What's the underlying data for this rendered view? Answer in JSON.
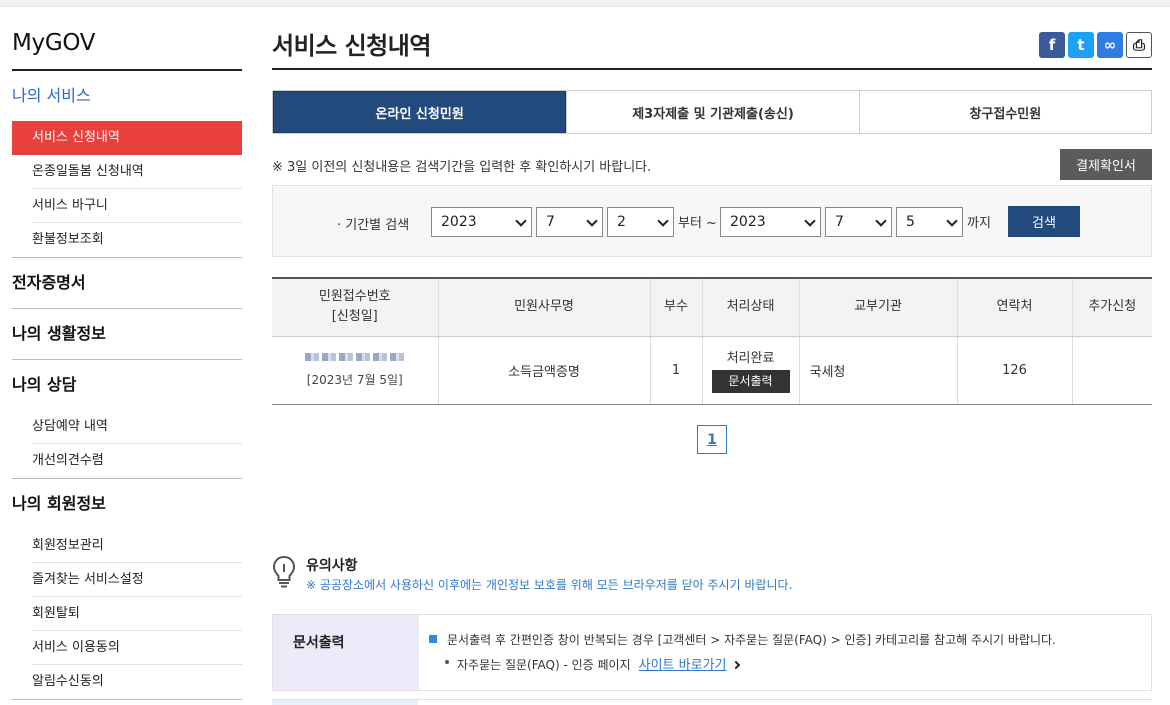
{
  "sidebar": {
    "brand": "MyGOV",
    "sections": [
      {
        "title": "나의 서비스",
        "items": [
          "서비스 신청내역",
          "온종일돌봄 신청내역",
          "서비스 바구니",
          "환불정보조회"
        ]
      },
      {
        "title": "전자증명서",
        "items": []
      },
      {
        "title": "나의 생활정보",
        "items": []
      },
      {
        "title": "나의 상담",
        "items": [
          "상담예약 내역",
          "개선의견수렴"
        ]
      },
      {
        "title": "나의 회원정보",
        "items": [
          "회원정보관리",
          "즐겨찾는 서비스설정",
          "회원탈퇴",
          "서비스 이용동의",
          "알림수신동의"
        ]
      }
    ]
  },
  "page": {
    "title": "서비스 신청내역",
    "share": {
      "facebook": "f",
      "twitter": "t",
      "link": "∞",
      "print": "⎙"
    }
  },
  "tabs": [
    "온라인 신청민원",
    "제3자제출 및 기관제출(송신)",
    "창구접수민원"
  ],
  "notice": "※ 3일 이전의 신청내용은 검색기간을 입력한 후 확인하시기 바랍니다.",
  "receipt_button": "결제확인서",
  "search": {
    "label": "· 기간별 검색",
    "from": {
      "year": "2023",
      "month": "7",
      "day": "2"
    },
    "from_suffix": "부터 ~",
    "to": {
      "year": "2023",
      "month": "7",
      "day": "5"
    },
    "to_suffix": "까지",
    "button": "검색"
  },
  "table": {
    "headers": [
      "민원접수번호",
      "[신청일]",
      "민원사무명",
      "부수",
      "처리상태",
      "교부기관",
      "연락처",
      "추가신청"
    ],
    "row": {
      "date": "[2023년 7월 5일]",
      "service": "소득금액증명",
      "copies": "1",
      "status": "처리완료",
      "print_button": "문서출력",
      "agency": "국세청",
      "contact": "126",
      "extra": ""
    }
  },
  "pagination": {
    "current": "1"
  },
  "caution": {
    "title": "유의사항",
    "subtitle": "※ 공공장소에서 사용하신 이후에는 개인정보 보호를 위해 모든 브라우저를 닫아 주시기 바랍니다."
  },
  "info": {
    "label": "문서출력",
    "line1": "문서출력 후 간편인증 창이 반복되는 경우 [고객센터 > 자주묻는 질문(FAQ) > 인증] 카테고리를 참고해 주시기 바랍니다.",
    "line2": "자주묻는 질문(FAQ) - 인증 페이지",
    "link": "사이트 바로가기"
  }
}
